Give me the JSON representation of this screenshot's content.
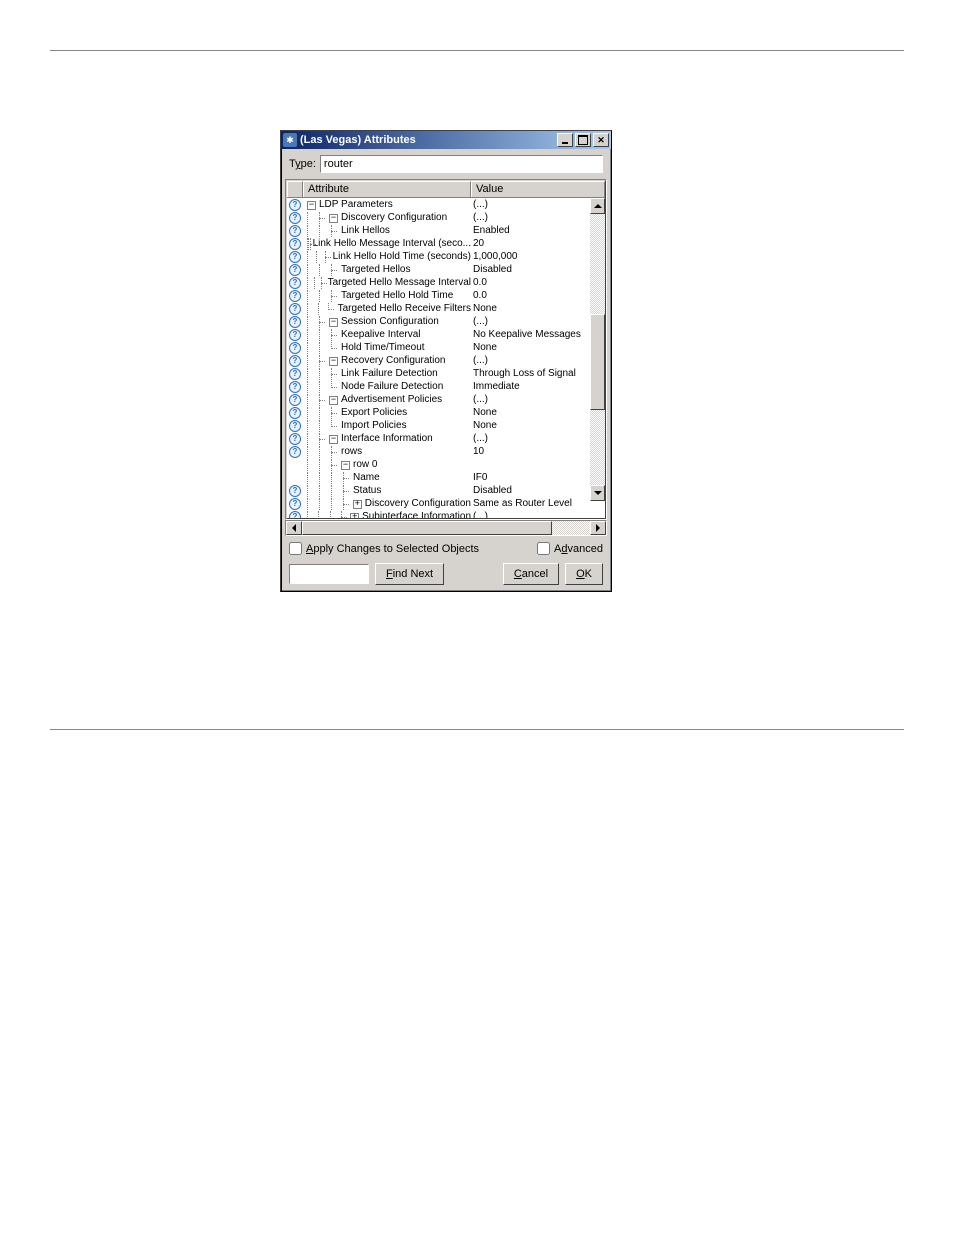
{
  "window": {
    "title": "(Las Vegas) Attributes"
  },
  "type_label_pre": "T",
  "type_label_u": "y",
  "type_label_post": "pe:",
  "type_value": "router",
  "columns": {
    "attribute": "Attribute",
    "value": "Value"
  },
  "rows": [
    {
      "depth": 0,
      "toggle": "minus",
      "help": true,
      "label": "LDP Parameters",
      "value": "(...)"
    },
    {
      "depth": 1,
      "toggle": "minus",
      "help": true,
      "label": "Discovery Configuration",
      "value": "(...)"
    },
    {
      "depth": 2,
      "toggle": "",
      "help": true,
      "label": "Link Hellos",
      "value": "Enabled"
    },
    {
      "depth": 2,
      "toggle": "",
      "help": true,
      "label": "Link Hello Message Interval (seco...",
      "value": "20"
    },
    {
      "depth": 2,
      "toggle": "",
      "help": true,
      "label": "Link Hello Hold Time (seconds)",
      "value": "1,000,000"
    },
    {
      "depth": 2,
      "toggle": "",
      "help": true,
      "label": "Targeted Hellos",
      "value": "Disabled"
    },
    {
      "depth": 2,
      "toggle": "",
      "help": true,
      "label": "Targeted Hello Message Interval",
      "value": "0.0"
    },
    {
      "depth": 2,
      "toggle": "",
      "help": true,
      "label": "Targeted Hello Hold Time",
      "value": "0.0"
    },
    {
      "depth": 2,
      "toggle": "",
      "help": true,
      "label": "Targeted Hello Receive Filters",
      "value": "None",
      "last": true
    },
    {
      "depth": 1,
      "toggle": "minus",
      "help": true,
      "label": "Session Configuration",
      "value": "(...)"
    },
    {
      "depth": 2,
      "toggle": "",
      "help": true,
      "label": "Keepalive Interval",
      "value": "No Keepalive Messages"
    },
    {
      "depth": 2,
      "toggle": "",
      "help": true,
      "label": "Hold Time/Timeout",
      "value": "None",
      "last": true
    },
    {
      "depth": 1,
      "toggle": "minus",
      "help": true,
      "label": "Recovery Configuration",
      "value": "(...)"
    },
    {
      "depth": 2,
      "toggle": "",
      "help": true,
      "label": "Link Failure Detection",
      "value": "Through Loss of Signal"
    },
    {
      "depth": 2,
      "toggle": "",
      "help": true,
      "label": "Node Failure Detection",
      "value": "Immediate",
      "last": true
    },
    {
      "depth": 1,
      "toggle": "minus",
      "help": true,
      "label": "Advertisement Policies",
      "value": "(...)"
    },
    {
      "depth": 2,
      "toggle": "",
      "help": true,
      "label": "Export Policies",
      "value": "None"
    },
    {
      "depth": 2,
      "toggle": "",
      "help": true,
      "label": "Import Policies",
      "value": "None",
      "last": true
    },
    {
      "depth": 1,
      "toggle": "minus",
      "help": true,
      "label": "Interface Information",
      "value": "(...)"
    },
    {
      "depth": 2,
      "toggle": "",
      "help": true,
      "label": "rows",
      "value": "10"
    },
    {
      "depth": 2,
      "toggle": "minus",
      "help": false,
      "label": "row 0",
      "value": ""
    },
    {
      "depth": 3,
      "toggle": "",
      "help": false,
      "label": "Name",
      "value": "IF0"
    },
    {
      "depth": 3,
      "toggle": "",
      "help": true,
      "label": "Status",
      "value": "Disabled"
    },
    {
      "depth": 3,
      "toggle": "plus",
      "help": true,
      "label": "Discovery Configuration",
      "value": "Same as Router Level"
    },
    {
      "depth": 3,
      "toggle": "plus",
      "help": true,
      "label": "Subinterface Information",
      "value": "(...)"
    }
  ],
  "apply_label_u": "A",
  "apply_label_rest": "pply Changes to Selected Objects",
  "advanced_pre": "A",
  "advanced_u": "d",
  "advanced_post": "vanced",
  "find_u": "F",
  "find_rest": "ind Next",
  "cancel_u": "C",
  "cancel_rest": "ancel",
  "ok_u": "O",
  "ok_rest": "K"
}
